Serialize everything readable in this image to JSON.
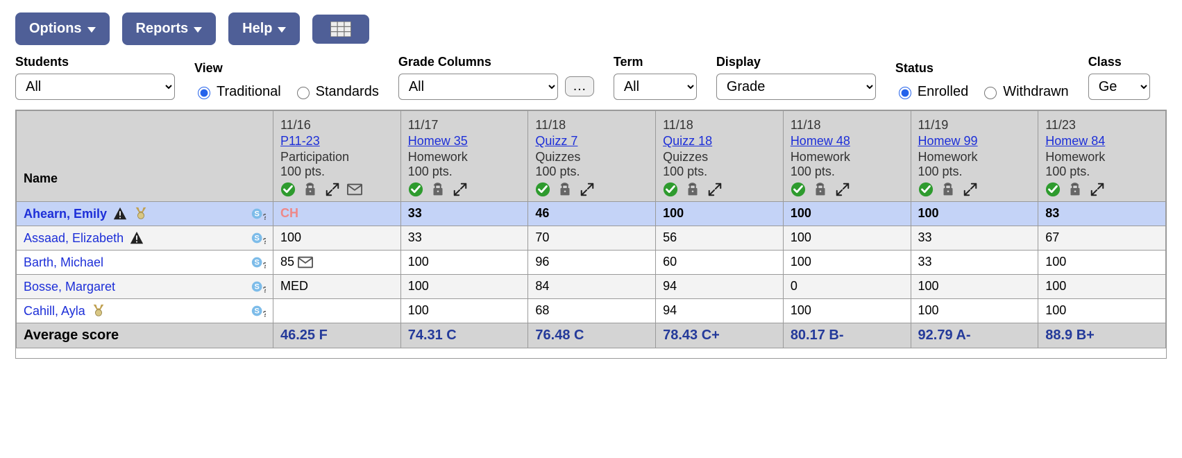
{
  "toolbar": {
    "options": "Options",
    "reports": "Reports",
    "help": "Help"
  },
  "filters": {
    "students_label": "Students",
    "students_value": "All",
    "view_label": "View",
    "view_traditional": "Traditional",
    "view_standards": "Standards",
    "grade_columns_label": "Grade Columns",
    "grade_columns_value": "All",
    "more_btn": "…",
    "term_label": "Term",
    "term_value": "All",
    "display_label": "Display",
    "display_value": "Grade",
    "status_label": "Status",
    "status_enrolled": "Enrolled",
    "status_withdrawn": "Withdrawn",
    "class_label": "Class",
    "class_value": "Ge"
  },
  "columns": [
    {
      "date": "11/16",
      "link": "P11-23",
      "category": "Participation",
      "pts": "100 pts.",
      "mail": true
    },
    {
      "date": "11/17",
      "link": "Homew 35",
      "category": "Homework",
      "pts": "100 pts.",
      "mail": false
    },
    {
      "date": "11/18",
      "link": "Quizz 7",
      "category": "Quizzes",
      "pts": "100 pts.",
      "mail": false
    },
    {
      "date": "11/18",
      "link": "Quizz 18",
      "category": "Quizzes",
      "pts": "100 pts.",
      "mail": false
    },
    {
      "date": "11/18",
      "link": "Homew 48",
      "category": "Homework",
      "pts": "100 pts.",
      "mail": false
    },
    {
      "date": "11/19",
      "link": "Homew 99",
      "category": "Homework",
      "pts": "100 pts.",
      "mail": false
    },
    {
      "date": "11/23",
      "link": "Homew 84",
      "category": "Homework",
      "pts": "100 pts.",
      "mail": false
    }
  ],
  "name_header": "Name",
  "rows": [
    {
      "name": "Ahearn, Emily",
      "warn": true,
      "medal": true,
      "selected": true,
      "cells": [
        {
          "v": "CH",
          "ch": true
        },
        {
          "v": "33"
        },
        {
          "v": "46"
        },
        {
          "v": "100"
        },
        {
          "v": "100"
        },
        {
          "v": "100"
        },
        {
          "v": "83"
        }
      ]
    },
    {
      "name": "Assaad, Elizabeth",
      "warn": true,
      "medal": false,
      "selected": false,
      "cells": [
        {
          "v": "100"
        },
        {
          "v": "33"
        },
        {
          "v": "70"
        },
        {
          "v": "56"
        },
        {
          "v": "100"
        },
        {
          "v": "33"
        },
        {
          "v": "67"
        }
      ]
    },
    {
      "name": "Barth, Michael",
      "warn": false,
      "medal": false,
      "selected": false,
      "cells": [
        {
          "v": "85",
          "mail": true
        },
        {
          "v": "100"
        },
        {
          "v": "96"
        },
        {
          "v": "60"
        },
        {
          "v": "100"
        },
        {
          "v": "33"
        },
        {
          "v": "100"
        }
      ]
    },
    {
      "name": "Bosse, Margaret",
      "warn": false,
      "medal": false,
      "selected": false,
      "cells": [
        {
          "v": "MED"
        },
        {
          "v": "100"
        },
        {
          "v": "84"
        },
        {
          "v": "94"
        },
        {
          "v": "0"
        },
        {
          "v": "100"
        },
        {
          "v": "100"
        }
      ]
    },
    {
      "name": "Cahill, Ayla",
      "warn": false,
      "medal": true,
      "selected": false,
      "cells": [
        {
          "v": ""
        },
        {
          "v": "100"
        },
        {
          "v": "68"
        },
        {
          "v": "94"
        },
        {
          "v": "100"
        },
        {
          "v": "100"
        },
        {
          "v": "100"
        }
      ]
    }
  ],
  "footer": {
    "label": "Average score",
    "values": [
      "46.25 F",
      "74.31 C",
      "76.48 C",
      "78.43 C+",
      "80.17 B-",
      "92.79 A-",
      "88.9 B+"
    ]
  }
}
